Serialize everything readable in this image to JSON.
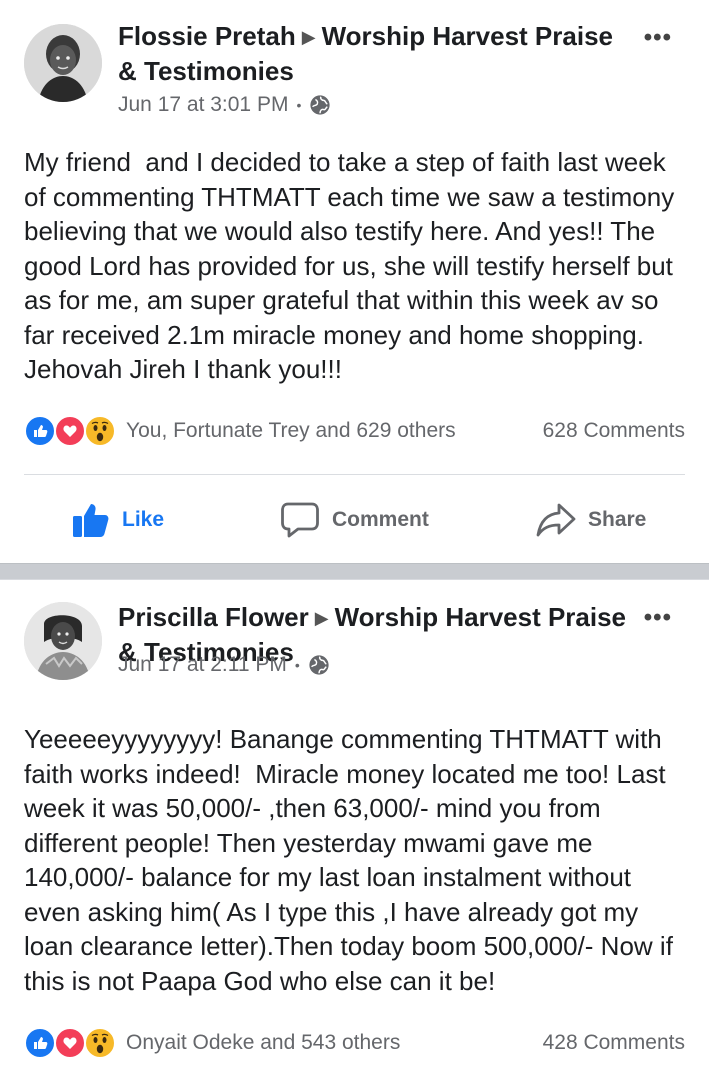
{
  "posts": [
    {
      "author": "Flossie Pretah",
      "group": "Worship Harvest Praise & Testimonies",
      "timestamp": "Jun 17 at 3:01 PM",
      "privacy_icon": "globe-icon",
      "body": "My friend  and I decided to take a step of faith last week of commenting THTMATT each time we saw a testimony believing that we would also testify here. And yes!! The good Lord has provided for us, she will testify herself but as for me, am super grateful that within this week av so far received 2.1m miracle money and home shopping. Jehovah Jireh I thank you!!!",
      "reactions_text": "You, Fortunate Trey and 629 others",
      "comments_text": "628 Comments"
    },
    {
      "author": "Priscilla Flower",
      "group": "Worship Harvest Praise & Testimonies",
      "timestamp": "Jun 17 at 2:11 PM",
      "privacy_icon": "globe-icon",
      "body": "Yeeeeeyyyyyyyy! Banange commenting THTMATT with faith works indeed!  Miracle money located me too! Last week it was 50,000/- ,then 63,000/- mind you from different people! Then yesterday mwami gave me 140,000/- balance for my last loan instalment without even asking him( As I type this ,I have already got my loan clearance letter).Then today boom 500,000/- Now if this is not Paapa God who else can it be!",
      "reactions_text": "Onyait Odeke and 543 others",
      "comments_text": "428 Comments"
    }
  ],
  "actions": {
    "like_label": "Like",
    "comment_label": "Comment",
    "share_label": "Share"
  },
  "more_glyph": "•••",
  "colors": {
    "like_blue": "#1877f2",
    "love_red": "#f33e58",
    "wow_yellow": "#f7b928",
    "secondary_text": "#65676b",
    "separator": "#c9ccd1"
  }
}
